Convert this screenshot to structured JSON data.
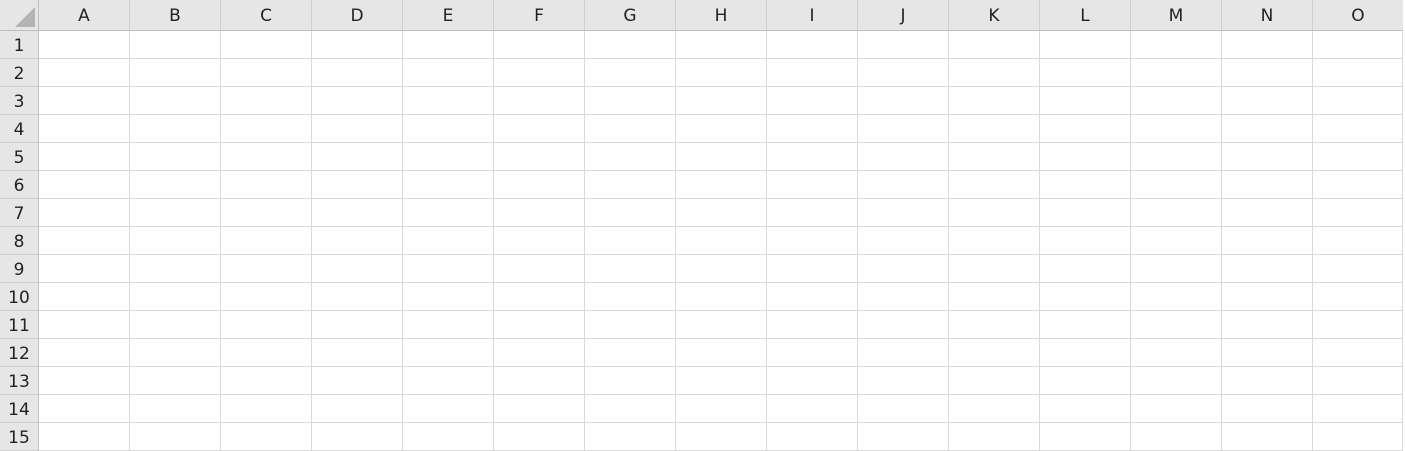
{
  "columns": [
    "A",
    "B",
    "C",
    "D",
    "E",
    "F",
    "G",
    "H",
    "I",
    "J",
    "K",
    "L",
    "M",
    "N",
    "O"
  ],
  "rows": [
    "1",
    "2",
    "3",
    "4",
    "5",
    "6",
    "7",
    "8",
    "9",
    "10",
    "11",
    "12",
    "13",
    "14",
    "15"
  ],
  "cells": []
}
